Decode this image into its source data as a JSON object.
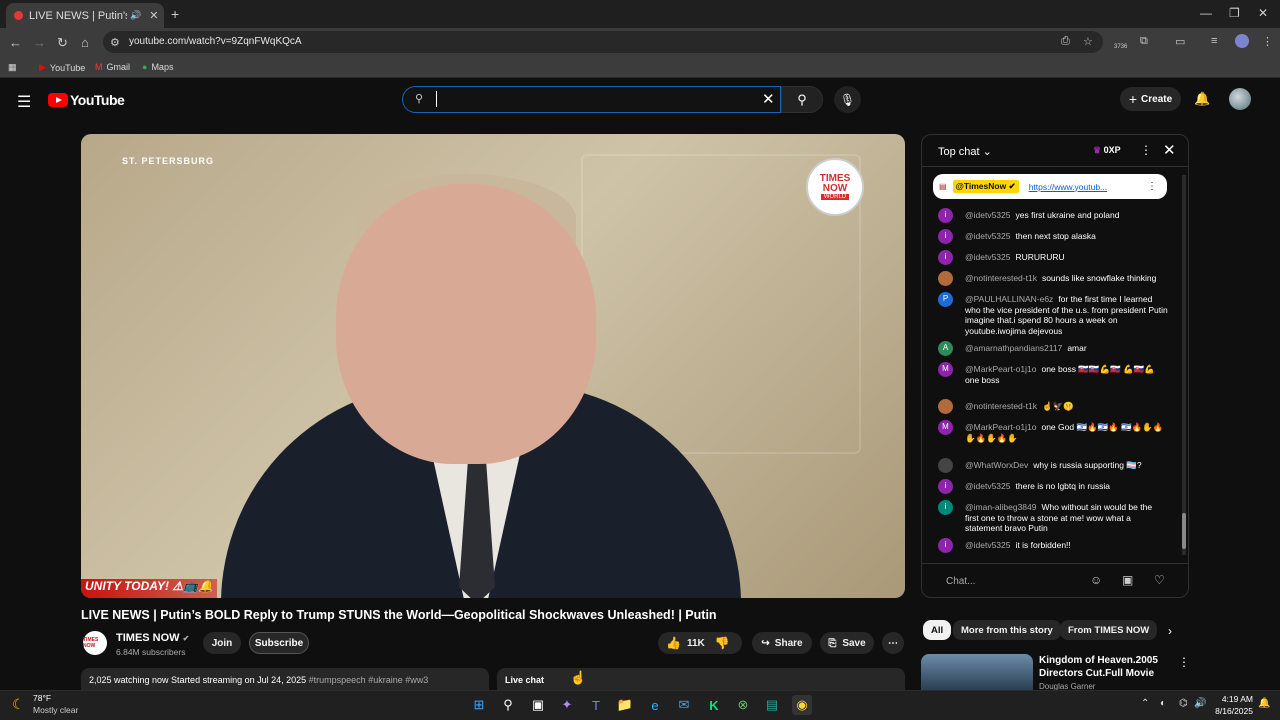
{
  "browser": {
    "tab_title": "LIVE NEWS | Putin's BOLD R",
    "url": "youtube.com/watch?v=9ZqnFWqKQcA",
    "bookmarks": [
      "YouTube",
      "Gmail",
      "Maps"
    ],
    "ext_badge": "3736"
  },
  "header": {
    "logo_text": "YouTube",
    "search_value": "",
    "create_label": "Create"
  },
  "video": {
    "overlay_location": "ST. PETERSBURG",
    "overlay_logo_line1": "TIMES",
    "overlay_logo_line2": "NOW",
    "overlay_logo_line3": "WORLD",
    "ticker": "UNITY TODAY! ⚠📺🔔",
    "title": "LIVE NEWS | Putin’s BOLD Reply to Trump STUNS the World—Geopolitical Shockwaves Unleashed! | Putin"
  },
  "channel": {
    "logo_text": "TIMES NOW",
    "name": "TIMES NOW",
    "verified": "✔",
    "subscribers": "6.84M subscribers",
    "join_label": "Join",
    "subscribe_label": "Subscribe",
    "like_count": "11K",
    "share_label": "Share",
    "save_label": "Save"
  },
  "description": {
    "meta": "2,025 watching now  Started streaming on Jul 24, 2025",
    "tags": "#trumpspeech #ukraine #ww3",
    "live_chat_label": "Live chat"
  },
  "chat": {
    "header": "Top chat",
    "xp": "0XP",
    "pinned_author": "@TimesNow ✔",
    "pinned_link": "https://www.youtub...",
    "input_placeholder": "Chat...",
    "messages": [
      {
        "initial": "i",
        "color": "#8e24aa",
        "author": "@idetv5325",
        "text": "yes first ukraine and poland"
      },
      {
        "initial": "i",
        "color": "#8e24aa",
        "author": "@idetv5325",
        "text": "then next stop alaska"
      },
      {
        "initial": "i",
        "color": "#8e24aa",
        "author": "@idetv5325",
        "text": "RURURURU"
      },
      {
        "initial": "",
        "color": "#b26a3b",
        "author": "@notinterested-t1k",
        "text": "sounds like snowflake thinking"
      },
      {
        "initial": "P",
        "color": "#1e6bd6",
        "author": "@PAULHALLINAN-e6z",
        "text": "for the first time I learned who the vice president of the u.s. from president Putin imagine that.i spend 80 hours a week on youtube.iwojima dejevous"
      },
      {
        "initial": "A",
        "color": "#2e8b57",
        "author": "@amarnathpandians2117",
        "text": "amar"
      },
      {
        "initial": "M",
        "color": "#8e24aa",
        "author": "@MarkPeart-o1j1o",
        "text": "one boss 🇸🇰🇸🇰💪🇸🇰 💪🇸🇰💪 one boss"
      },
      {
        "initial": "",
        "color": "#b26a3b",
        "author": "@notinterested-t1k",
        "text": "☝️🦅🤫"
      },
      {
        "initial": "M",
        "color": "#8e24aa",
        "author": "@MarkPeart-o1j1o",
        "text": "one God 🇮🇱🔥🇮🇱🔥 🇮🇱🔥✋🔥✋🔥✋🔥✋"
      },
      {
        "initial": "",
        "color": "#444444",
        "author": "@WhatWorxDev",
        "text": "why is russia supporting 🏳️‍⚧️?"
      },
      {
        "initial": "i",
        "color": "#8e24aa",
        "author": "@idetv5325",
        "text": "there is no lgbtq in russia"
      },
      {
        "initial": "i",
        "color": "#00897b",
        "author": "@iman-alibeg3849",
        "text": "Who without sin would be the first one to throw a stone at me! wow what a statement bravo Putin"
      },
      {
        "initial": "i",
        "color": "#8e24aa",
        "author": "@idetv5325",
        "text": "it is forbidden!!"
      }
    ]
  },
  "related": {
    "chips": [
      "All",
      "More from this story",
      "From TIMES NOW"
    ],
    "first_title": "Kingdom of Heaven.2005 Directors Cut.Full Movie",
    "first_channel": "Douglas Garner"
  },
  "taskbar": {
    "temp": "78°F",
    "weather": "Mostly clear",
    "time": "4:19 AM",
    "date": "8/16/2025"
  }
}
